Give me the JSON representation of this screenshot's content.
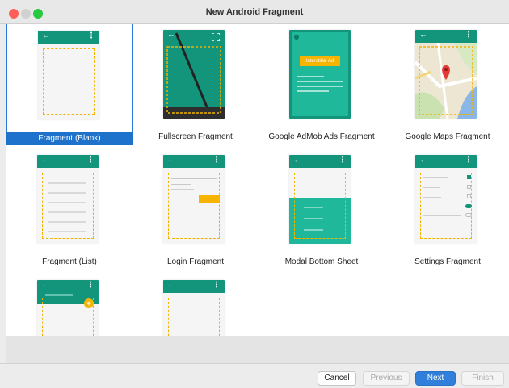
{
  "window": {
    "title": "New Android Fragment"
  },
  "gallery": {
    "items": [
      {
        "label": "Fragment (Blank)",
        "selected": true
      },
      {
        "label": "Fullscreen Fragment",
        "selected": false
      },
      {
        "label": "Google AdMob Ads Fragment",
        "selected": false,
        "thumb_text": "Interstitial Ad"
      },
      {
        "label": "Google Maps Fragment",
        "selected": false
      },
      {
        "label": "Fragment (List)",
        "selected": false
      },
      {
        "label": "Login Fragment",
        "selected": false
      },
      {
        "label": "Modal Bottom Sheet",
        "selected": false
      },
      {
        "label": "Settings Fragment",
        "selected": false
      },
      {
        "label": "",
        "selected": false
      },
      {
        "label": "",
        "selected": false
      }
    ]
  },
  "footer": {
    "cancel_label": "Cancel",
    "previous_label": "Previous",
    "next_label": "Next",
    "finish_label": "Finish"
  },
  "icons": {
    "appbar_back": "←",
    "appbar_more": "⋮",
    "fullscreen": "fullscreen-icon",
    "map_pin": "map-pin-icon",
    "fab_add": "add-icon"
  },
  "colors": {
    "app_bar": "#13957b",
    "selection": "#1f72cc",
    "placeholder_dash": "#f0b400",
    "next_button": "#2f7fdb"
  }
}
